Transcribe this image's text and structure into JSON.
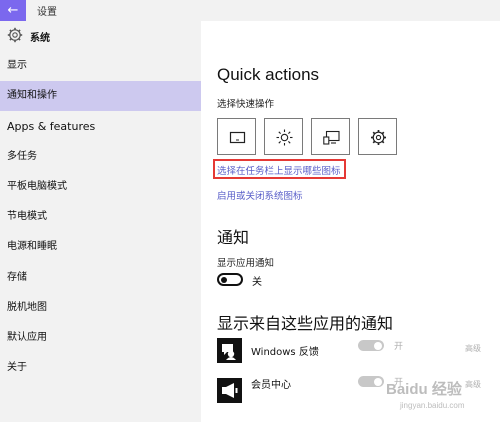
{
  "window": {
    "back_glyph": "←",
    "title": "设置"
  },
  "sidebar": {
    "header": "系统",
    "items": [
      {
        "label": "显示",
        "active": false
      },
      {
        "label": "通知和操作",
        "active": true
      },
      {
        "label": "Apps & features",
        "active": false
      },
      {
        "label": "多任务",
        "active": false
      },
      {
        "label": "平板电脑模式",
        "active": false
      },
      {
        "label": "节电模式",
        "active": false
      },
      {
        "label": "电源和睡眠",
        "active": false
      },
      {
        "label": "存储",
        "active": false
      },
      {
        "label": "脱机地图",
        "active": false
      },
      {
        "label": "默认应用",
        "active": false
      },
      {
        "label": "关于",
        "active": false
      }
    ]
  },
  "main": {
    "quick_actions_title": "Quick actions",
    "choose_quick_label": "选择快速操作",
    "tiles": [
      "tablet-mode-icon",
      "brightness-icon",
      "connect-display-icon",
      "settings-icon"
    ],
    "link_taskbar_icons": "选择在任务栏上显示哪些图标",
    "link_system_icons": "启用或关闭系统图标",
    "notifications_title": "通知",
    "show_app_notifications_label": "显示应用通知",
    "toggle_state": "关",
    "from_apps_title": "显示来自这些应用的通知",
    "apps": [
      {
        "name": "Windows 反馈",
        "state": "开",
        "advanced": "高级",
        "icon": "feedback-icon"
      },
      {
        "name": "会员中心",
        "state": "开",
        "advanced": "高级",
        "icon": "member-center-icon"
      }
    ]
  },
  "watermark": {
    "brand": "Baidu 经验",
    "url": "jingyan.baidu.com"
  },
  "colors": {
    "accent": "#7b68ee",
    "active_bg": "#cdc9ef",
    "link": "#5a5fc9",
    "highlight_box": "#e53935"
  }
}
